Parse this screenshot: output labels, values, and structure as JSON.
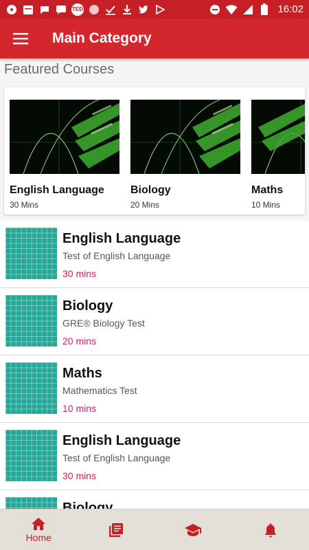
{
  "status_bar": {
    "time": "16:02",
    "ted_badge": "TED"
  },
  "app_bar": {
    "title": "Main Category"
  },
  "featured": {
    "heading": "Featured Courses",
    "courses": [
      {
        "name": "English Language",
        "duration": "30 Mins"
      },
      {
        "name": "Biology",
        "duration": "20 Mins"
      },
      {
        "name": "Maths",
        "duration": "10 Mins"
      }
    ]
  },
  "courses": [
    {
      "title": "English Language",
      "subtitle": "Test of English Language",
      "duration": "30 mins"
    },
    {
      "title": "Biology",
      "subtitle": "GRE® Biology Test",
      "duration": "20 mins"
    },
    {
      "title": "Maths",
      "subtitle": "Mathematics Test",
      "duration": "10 mins"
    },
    {
      "title": "English Language",
      "subtitle": "Test of English Language",
      "duration": "30 mins"
    },
    {
      "title": "Biology",
      "subtitle": "",
      "duration": ""
    }
  ],
  "bottom_nav": {
    "home_label": "Home"
  },
  "colors": {
    "primary": "#d3262d",
    "accent_duration": "#d81b60",
    "thumb_teal": "#25a898"
  }
}
